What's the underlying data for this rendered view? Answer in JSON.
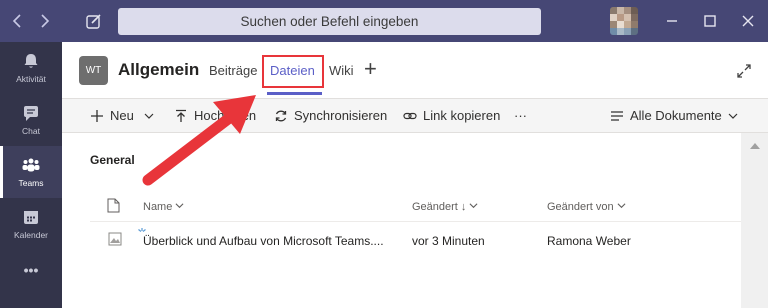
{
  "titlebar": {
    "back_icon": "chevron-left-icon",
    "forward_icon": "chevron-right-icon",
    "compose_icon": "compose-icon",
    "search_placeholder": "Suchen oder Befehl eingeben"
  },
  "rail": {
    "items": [
      {
        "label": "Aktivität",
        "icon": "bell-icon"
      },
      {
        "label": "Chat",
        "icon": "chat-icon"
      },
      {
        "label": "Teams",
        "icon": "teams-icon",
        "active": true
      },
      {
        "label": "Kalender",
        "icon": "calendar-icon"
      },
      {
        "label": "•••",
        "icon": "more-icon"
      }
    ]
  },
  "header": {
    "badge": "WT",
    "team_name": "Allgemein",
    "tabs": [
      {
        "label": "Beiträge"
      },
      {
        "label": "Dateien",
        "active": true
      },
      {
        "label": "Wiki"
      }
    ],
    "add_tab": "+"
  },
  "toolbar": {
    "new": "Neu",
    "upload": "Hochladen",
    "sync": "Synchronisieren",
    "copy_link": "Link kopieren",
    "more": "···",
    "view": "Alle Dokumente"
  },
  "files": {
    "folder": "General",
    "columns": {
      "name": "Name",
      "modified": "Geändert ↓",
      "modified_by": "Geändert von"
    },
    "rows": [
      {
        "name": "Überblick und Aufbau von Microsoft Teams....",
        "modified": "vor 3 Minuten",
        "modified_by": "Ramona Weber"
      }
    ]
  },
  "colors": {
    "titlebar": "#464775",
    "rail": "#33344a",
    "accent": "#5b5fc7",
    "annotation": "#e8353a"
  }
}
